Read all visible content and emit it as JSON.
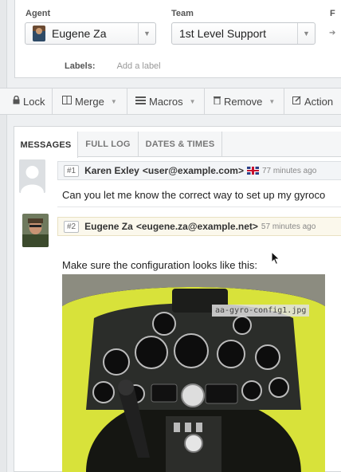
{
  "properties": {
    "agent_label": "Agent",
    "agent_value": "Eugene Za",
    "team_label": "Team",
    "team_value": "1st Level Support",
    "third_label_partial": "F",
    "labels_key": "Labels:",
    "labels_placeholder": "Add a label"
  },
  "toolbar": {
    "lock": "Lock",
    "merge": "Merge",
    "macros": "Macros",
    "remove": "Remove",
    "actions_partial": "Action"
  },
  "tabs": [
    "MESSAGES",
    "FULL LOG",
    "DATES & TIMES"
  ],
  "messages": [
    {
      "num": "#1",
      "name": "Karen Exley",
      "email": "<user@example.com>",
      "time": "77 minutes ago",
      "body": "Can you let me know the correct way to set up my gyroco"
    },
    {
      "num": "#2",
      "name": "Eugene Za",
      "email": "<eugene.za@example.net>",
      "time": "57 minutes ago",
      "body": "Make sure the configuration looks like this:",
      "attachment": "aa-gyro-config1.jpg"
    }
  ],
  "colors": {
    "agent_header": "#fbf8ec",
    "customer_header": "#f3f5f7",
    "cockpit_yellow": "#d8e23a"
  },
  "icons": {
    "lock": "lock-icon",
    "merge": "merge-icon",
    "macros": "macros-icon",
    "remove": "trash-icon",
    "actions": "edit-icon",
    "flag": "uk-flag-icon"
  }
}
